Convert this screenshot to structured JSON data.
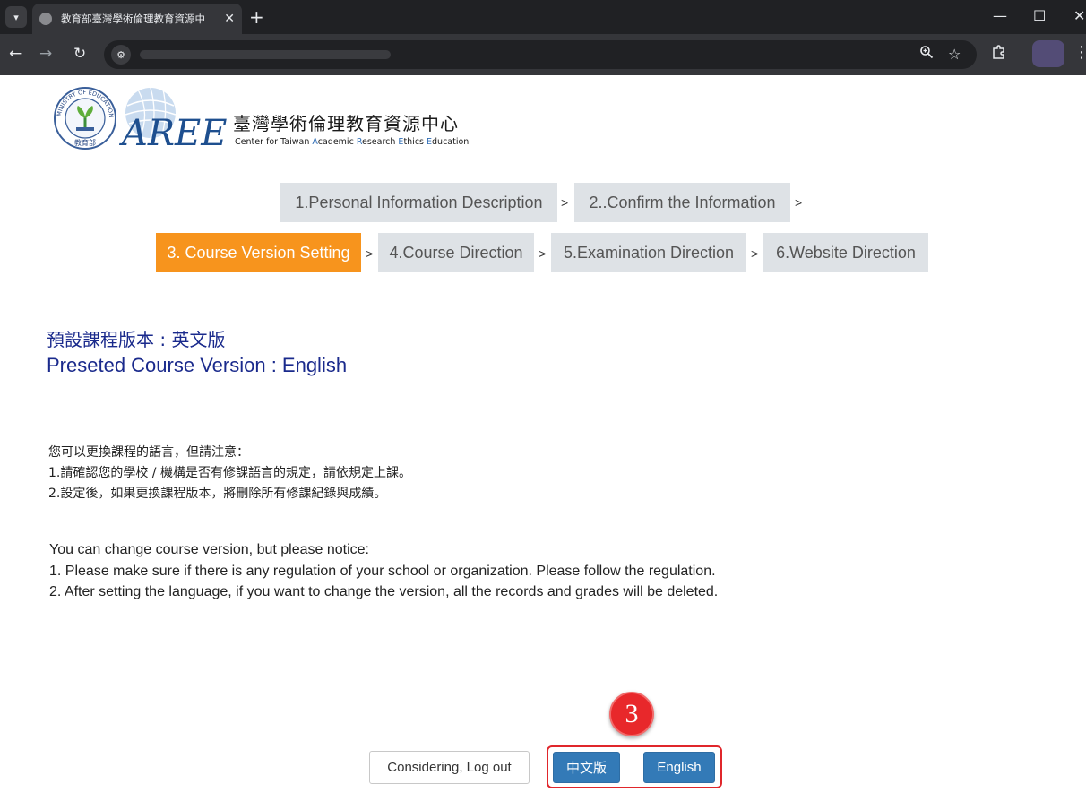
{
  "browser": {
    "tab_title": "教育部臺灣學術倫理教育資源中",
    "tab_close": "✕",
    "new_tab": "+",
    "minimize": "—",
    "maximize": "☐",
    "close": "✕",
    "tab_menu_icon": "chevron-down-icon"
  },
  "logo": {
    "name_cn": "臺灣學術倫理教育資源中心",
    "name_en_parts": [
      "Center for Taiwan ",
      "A",
      "cademic ",
      "R",
      "esearch ",
      "E",
      "thics ",
      "E",
      "ducation"
    ],
    "seal_top": "MINISTRY OF EDUCATION",
    "seal_bottom": "教育部",
    "mark": "AREE"
  },
  "steps": [
    {
      "label": "1.Personal Information Description",
      "active": false
    },
    {
      "label": "2..Confirm the Information",
      "active": false
    },
    {
      "label": "3. Course Version Setting",
      "active": true
    },
    {
      "label": "4.Course Direction",
      "active": false
    },
    {
      "label": "5.Examination Direction",
      "active": false
    },
    {
      "label": "6.Website Direction",
      "active": false
    }
  ],
  "step_separator": ">",
  "preset": {
    "cn": "預設課程版本 : 英文版",
    "en": "Preseted Course Version : English"
  },
  "notice_cn": [
    "您可以更換課程的語言，但請注意：",
    "1.請確認您的學校 / 機構是否有修課語言的規定，請依規定上課。",
    "2.設定後，如果更換課程版本，將刪除所有修課紀錄與成績。"
  ],
  "notice_en": [
    "You can change course version, but please notice:",
    "1. Please make sure if there is any regulation of your school or organization. Please follow the regulation.",
    "2. After setting the language, if you want to change the version, all the records and grades will be deleted."
  ],
  "buttons": {
    "logout": "Considering, Log out",
    "chinese": "中文版",
    "english": "English"
  },
  "annotation": {
    "marker_number": "3",
    "marker_color": "#e8282b",
    "box_color": "#e0262b"
  },
  "colors": {
    "active_step": "#f7941d",
    "inactive_step": "#dee2e6",
    "primary_button": "#337ab7",
    "heading_blue": "#1a2a8c"
  }
}
